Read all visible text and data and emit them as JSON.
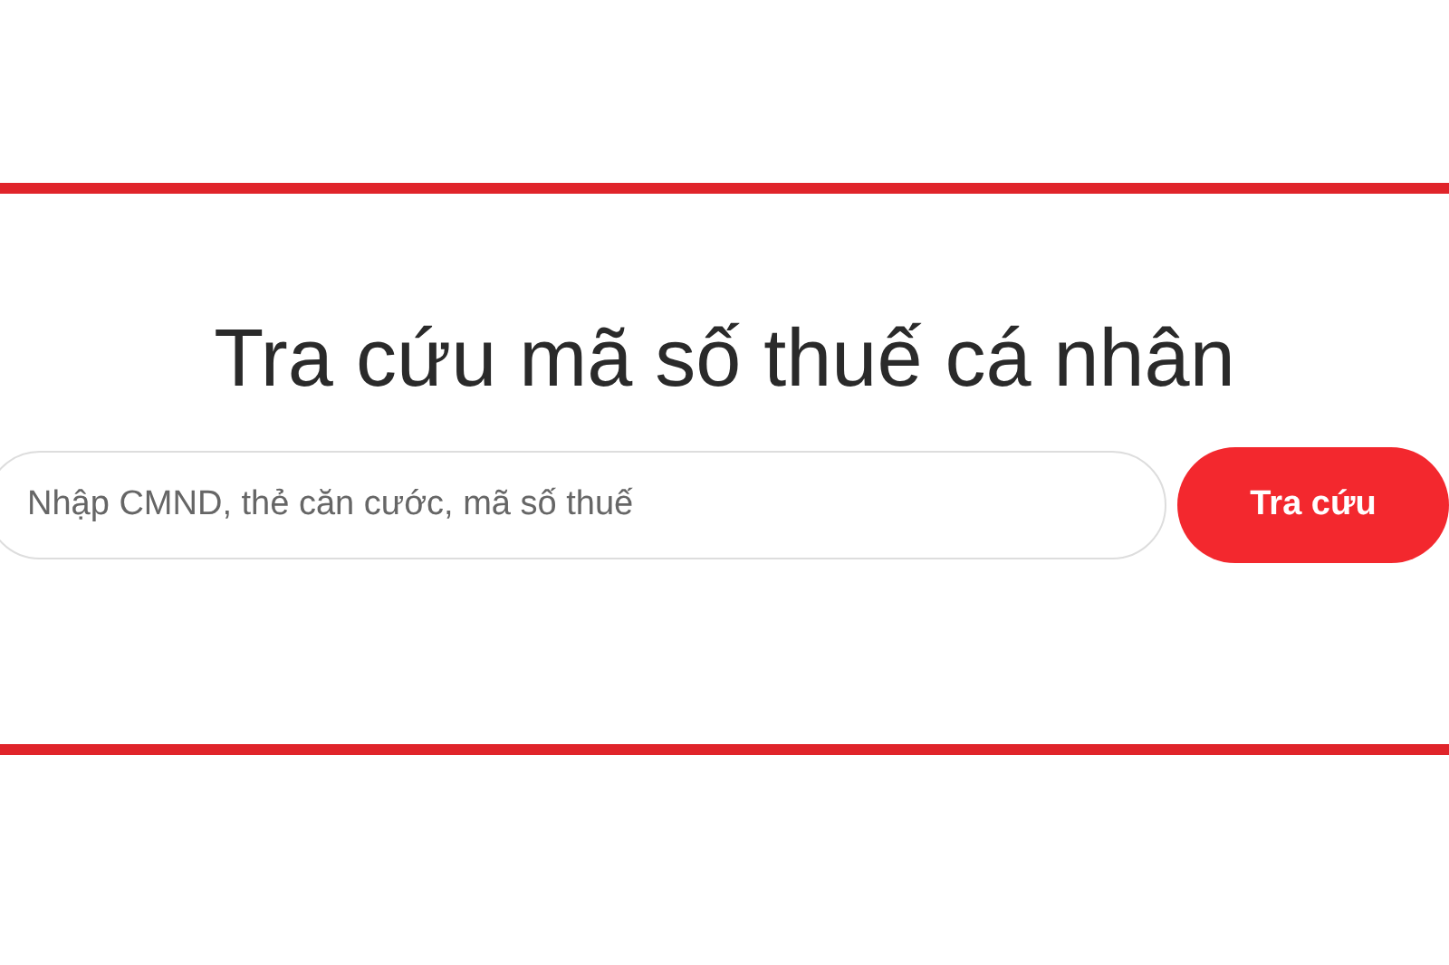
{
  "heading": "Tra cứu mã số thuế cá nhân",
  "search": {
    "placeholder": "Nhập CMND, thẻ căn cước, mã số thuế"
  },
  "button": "Tra cứu"
}
